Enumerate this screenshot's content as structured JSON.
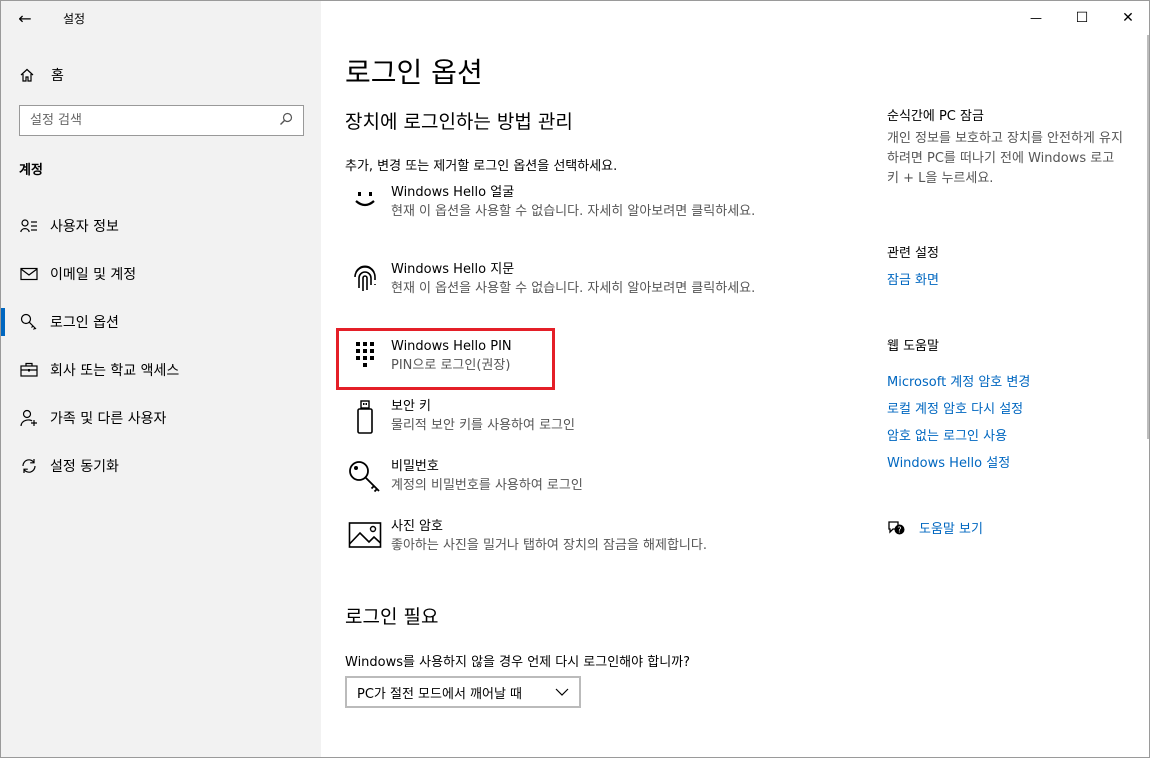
{
  "window": {
    "title": "설정",
    "back_glyph": "←",
    "minimize_glyph": "—",
    "maximize_glyph": "☐",
    "close_glyph": "✕"
  },
  "sidebar": {
    "home_label": "홈",
    "search_placeholder": "설정 검색",
    "section_label": "계정",
    "items": [
      {
        "label": "사용자 정보",
        "icon": "user-info-icon",
        "active": false
      },
      {
        "label": "이메일 및 계정",
        "icon": "mail-icon",
        "active": false
      },
      {
        "label": "로그인 옵션",
        "icon": "key-icon",
        "active": true
      },
      {
        "label": "회사 또는 학교 액세스",
        "icon": "briefcase-icon",
        "active": false
      },
      {
        "label": "가족 및 다른 사용자",
        "icon": "add-user-icon",
        "active": false
      },
      {
        "label": "설정 동기화",
        "icon": "sync-icon",
        "active": false
      }
    ]
  },
  "main": {
    "title": "로그인 옵션",
    "subtitle": "장치에 로그인하는 방법 관리",
    "instruction": "추가, 변경 또는 제거할 로그인 옵션을 선택하세요.",
    "options": [
      {
        "name": "Windows Hello 얼굴",
        "desc": "현재 이 옵션을 사용할 수 없습니다. 자세히 알아보려면 클릭하세요.",
        "icon": "face-icon"
      },
      {
        "name": "Windows Hello 지문",
        "desc": "현재 이 옵션을 사용할 수 없습니다. 자세히 알아보려면 클릭하세요.",
        "icon": "fingerprint-icon"
      },
      {
        "name": "Windows Hello PIN",
        "desc": "PIN으로 로그인(권장)",
        "icon": "pin-keypad-icon"
      },
      {
        "name": "보안 키",
        "desc": "물리적 보안 키를 사용하여 로그인",
        "icon": "usb-key-icon"
      },
      {
        "name": "비밀번호",
        "desc": "계정의 비밀번호를 사용하여 로그인",
        "icon": "password-key-icon"
      },
      {
        "name": "사진 암호",
        "desc": "좋아하는 사진을 밀거나 탭하여 장치의 잠금을 해제합니다.",
        "icon": "picture-icon"
      }
    ],
    "require_title": "로그인 필요",
    "require_question": "Windows를 사용하지 않을 경우 언제 다시 로그인해야 합니까?",
    "dropdown_value": "PC가 절전 모드에서 깨어날 때"
  },
  "right": {
    "lock_title": "순식간에 PC 잠금",
    "lock_text": "개인 정보를 보호하고 장치를 안전하게 유지하려면 PC를 떠나기 전에 Windows 로고 키 + L을 누르세요.",
    "related_title": "관련 설정",
    "related_link": "잠금 화면",
    "help_title": "웹 도움말",
    "help_links": [
      "Microsoft 계정 암호 변경",
      "로컬 계정 암호 다시 설정",
      "암호 없는 로그인 사용",
      "Windows Hello 설정"
    ],
    "get_help": "도움말 보기"
  },
  "colors": {
    "accent": "#0067c0",
    "highlight": "#e41f28",
    "sidebar_bg": "#f2f2f2"
  }
}
